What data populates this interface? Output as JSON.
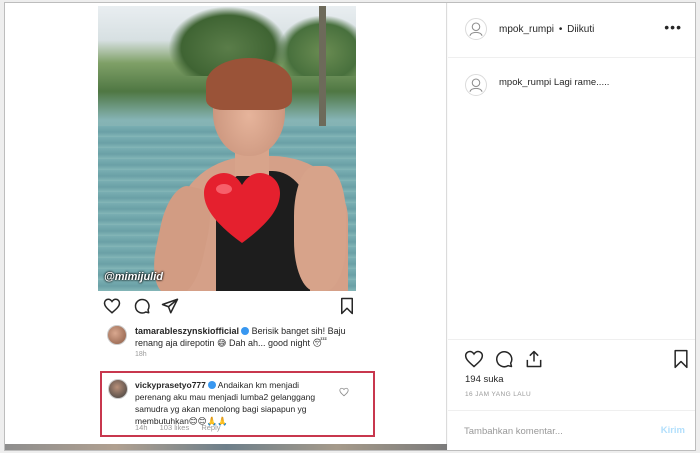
{
  "embedded_post": {
    "photo_watermark": "@mimijulid",
    "comments": [
      {
        "username": "tamarableszynskiofficial",
        "text": "Berisik banget sih! Baju renang aja direpotin 😅 Dah ah... good night 😴",
        "time": "18h"
      }
    ],
    "highlighted_comment": {
      "username": "vickyprasetyo777",
      "text": "Andaikan km menjadi perenang aku mau menjadi lumba2 gelanggang samudra yg akan menolong bagi siapapun yg membutuhkan😊😊🙏🙏",
      "time": "14h",
      "likes": "103 likes",
      "reply": "Reply"
    }
  },
  "sidebar": {
    "header": {
      "username": "mpok_rumpi",
      "separator": "•",
      "follow_status": "Diikuti"
    },
    "caption": {
      "username": "mpok_rumpi",
      "text": "Lagi rame....."
    },
    "likes_count": "194 suka",
    "time_ago": "16 JAM YANG LALU",
    "comment_input": {
      "placeholder": "Tambahkan komentar...",
      "send_label": "Kirim"
    }
  },
  "colors": {
    "highlight_border": "#c8374e",
    "verified_badge": "#3897f0",
    "heart_emoji": "#e5202e",
    "send_disabled": "#b2dffc"
  }
}
